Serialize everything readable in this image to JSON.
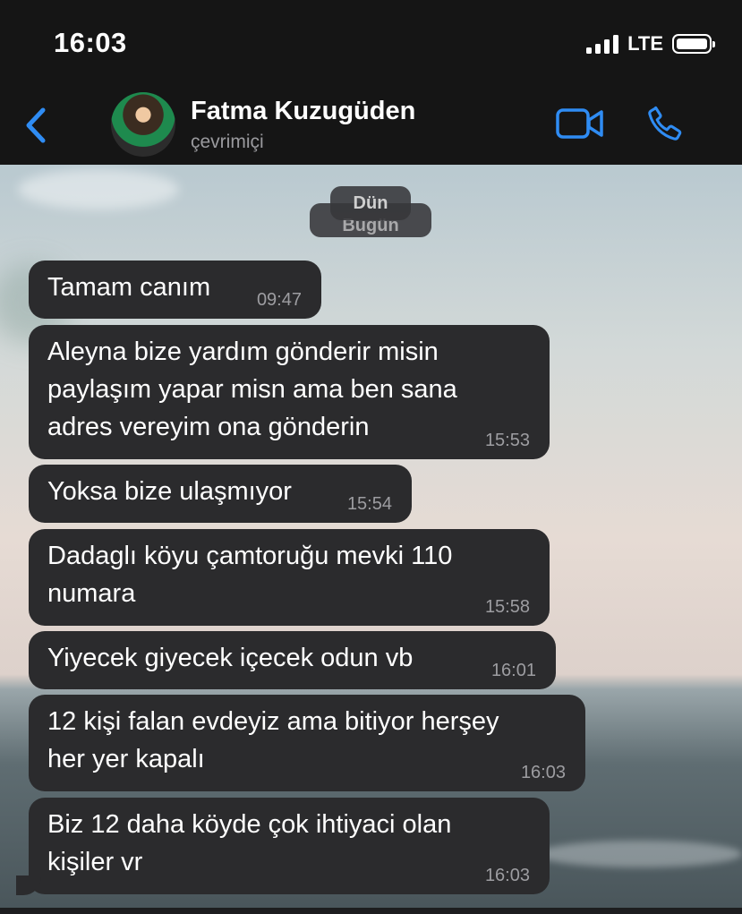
{
  "status_bar": {
    "time": "16:03",
    "network": "LTE",
    "battery_level": 1.0
  },
  "header": {
    "back_icon": "chevron-left-icon",
    "contact_name": "Fatma Kuzugüden",
    "contact_status": "çevrimiçi",
    "video_icon": "video-camera-icon",
    "call_icon": "phone-icon",
    "accent_color": "#2f8cf3"
  },
  "chat": {
    "date_separator_today": "Bugün",
    "date_separator_yesterday": "Dün",
    "messages": [
      {
        "text": "Tamam canım",
        "time": "09:47"
      },
      {
        "text": "Aleyna bize yardım gönderir misin\npaylaşım yapar misn ama ben sana\nadres vereyim ona gönderin",
        "time": "15:53"
      },
      {
        "text": "Yoksa bize ulaşmıyor",
        "time": "15:54"
      },
      {
        "text": "Dadaglı köyu çamtoruğu mevki 110\nnumara",
        "time": "15:58"
      },
      {
        "text": "Yiyecek giyecek içecek odun vb",
        "time": "16:01"
      },
      {
        "text": "12 kişi falan evdeyiz ama  bitiyor herşey\nher yer kapalı",
        "time": "16:03"
      },
      {
        "text": "Biz 12 daha köyde çok ihtiyaci olan\nkişiler vr",
        "time": "16:03"
      }
    ],
    "bubble_color": "#2b2b2d"
  }
}
